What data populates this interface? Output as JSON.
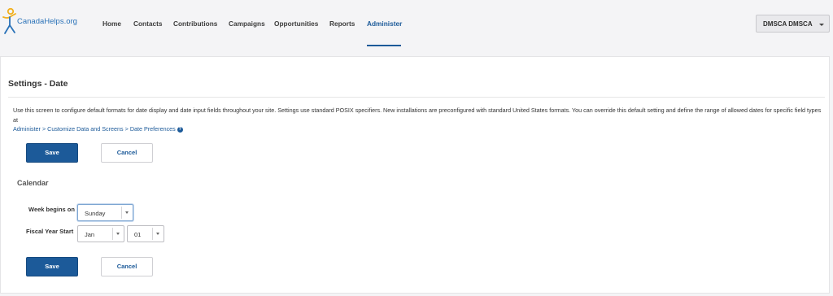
{
  "brand": {
    "logo_text": "CanadaHelps.org"
  },
  "nav": {
    "items": [
      {
        "label": "Home"
      },
      {
        "label": "Contacts"
      },
      {
        "label": "Contributions"
      },
      {
        "label": "Campaigns"
      },
      {
        "label": "Opportunities"
      },
      {
        "label": "Reports"
      },
      {
        "label": "Administer",
        "active": true
      }
    ]
  },
  "user_menu": {
    "label": "DMSCA DMSCA"
  },
  "page": {
    "title": "Settings - Date",
    "description": "Use this screen to configure default formats for date display and date input fields throughout your site. Settings use standard POSIX specifiers. New installations are preconfigured with standard United States formats. You can override this default setting and define the range of allowed dates for specific field types at",
    "link_text": "Administer > Customize Data and Screens > Date Preferences"
  },
  "buttons": {
    "save_label": "Save",
    "cancel_label": "Cancel"
  },
  "calendar": {
    "section_title": "Calendar",
    "week_begins_label": "Week begins on",
    "week_begins_value": "Sunday",
    "fiscal_year_label": "Fiscal Year Start",
    "fiscal_month_value": "Jan",
    "fiscal_day_value": "01"
  },
  "colors": {
    "accent": "#1c5a99",
    "panel_bg": "#ffffff",
    "page_bg": "#f4f4f6"
  },
  "icons": {
    "help": "question-circle-icon",
    "caret": "chevron-down-icon"
  }
}
